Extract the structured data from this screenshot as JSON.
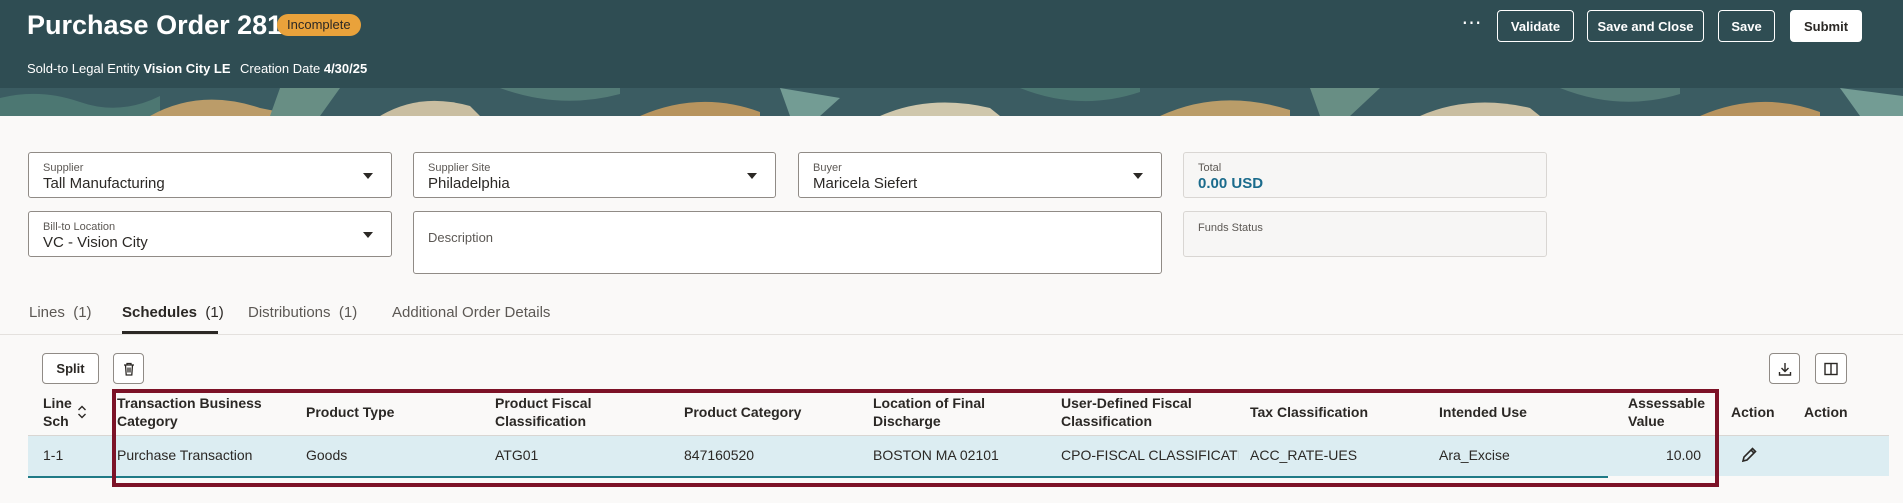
{
  "header": {
    "title": "Purchase Order 281",
    "status_badge": "Incomplete",
    "sold_to_label": "Sold-to Legal Entity",
    "sold_to_value": "Vision City LE",
    "creation_date_label": "Creation Date",
    "creation_date_value": "4/30/25",
    "more_icon": "more-horizontal-icon",
    "buttons": {
      "validate": "Validate",
      "save_and_close": "Save and Close",
      "save": "Save",
      "submit": "Submit"
    }
  },
  "form": {
    "supplier": {
      "label": "Supplier",
      "value": "Tall Manufacturing"
    },
    "supplier_site": {
      "label": "Supplier Site",
      "value": "Philadelphia"
    },
    "buyer": {
      "label": "Buyer",
      "value": "Maricela Siefert"
    },
    "total": {
      "label": "Total",
      "value": "0.00 USD"
    },
    "bill_to_location": {
      "label": "Bill-to Location",
      "value": "VC - Vision City"
    },
    "description": {
      "label": "Description",
      "value": ""
    },
    "funds_status": {
      "label": "Funds Status",
      "value": ""
    }
  },
  "tabs": [
    {
      "label": "Lines",
      "count": "(1)"
    },
    {
      "label": "Schedules",
      "count": "(1)"
    },
    {
      "label": "Distributions",
      "count": "(1)"
    },
    {
      "label": "Additional Order Details",
      "count": ""
    }
  ],
  "toolbar": {
    "split_label": "Split",
    "delete_icon": "trash-icon",
    "export_icon": "download-icon",
    "columns_icon": "column-layout-icon"
  },
  "table": {
    "headers": [
      {
        "line1": "Line",
        "line2": "Sch"
      },
      {
        "line1": "Transaction Business",
        "line2": "Category"
      },
      {
        "line1": "Product Type",
        "line2": ""
      },
      {
        "line1": "Product Fiscal",
        "line2": "Classification"
      },
      {
        "line1": "Product Category",
        "line2": ""
      },
      {
        "line1": "Location of Final",
        "line2": "Discharge"
      },
      {
        "line1": "User-Defined Fiscal",
        "line2": "Classification"
      },
      {
        "line1": "Tax Classification",
        "line2": ""
      },
      {
        "line1": "Intended Use",
        "line2": ""
      },
      {
        "line1": "Assessable",
        "line2": "Value"
      },
      {
        "line1": "Action",
        "line2": ""
      },
      {
        "line1": "Action",
        "line2": ""
      }
    ],
    "rows": [
      {
        "line_sch": "1-1",
        "transaction_business_category": "Purchase Transaction",
        "product_type": "Goods",
        "product_fiscal_classification": "ATG01",
        "product_category": "847160520",
        "location_of_final_discharge": "BOSTON MA 02101",
        "user_defined_fiscal_classification": "CPO-FISCAL CLASSIFICATI",
        "tax_classification": "ACC_RATE-UES",
        "intended_use": "Ara_Excise",
        "assessable_value": "10.00",
        "action_icon": "pencil-icon"
      }
    ]
  },
  "colors": {
    "header_bg": "#2f4d53",
    "badge_bg": "#e9a23b",
    "selected_row_bg": "#dcedf2",
    "highlight_border": "#7c1227",
    "link": "#1b6b8c"
  }
}
